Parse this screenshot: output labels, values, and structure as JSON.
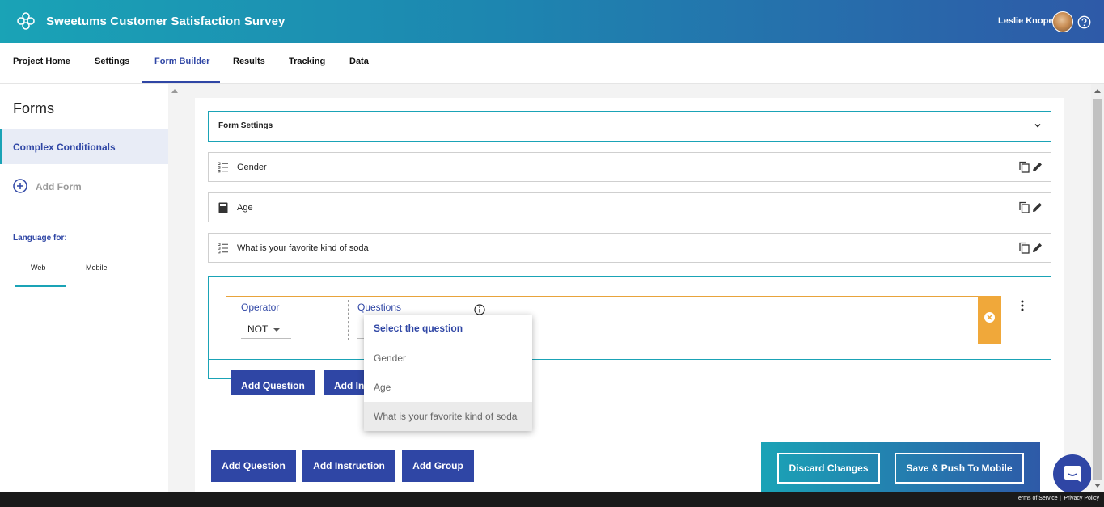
{
  "header": {
    "app_title": "Sweetums Customer Satisfaction Survey",
    "user_name": "Leslie Knope",
    "colors": {
      "gradient_start": "#1aa3b6",
      "gradient_end": "#2e5aa8"
    }
  },
  "tabs": [
    {
      "label": "Project Home"
    },
    {
      "label": "Settings"
    },
    {
      "label": "Form Builder",
      "active": true
    },
    {
      "label": "Results"
    },
    {
      "label": "Tracking"
    },
    {
      "label": "Data"
    }
  ],
  "sidebar": {
    "heading": "Forms",
    "forms": [
      {
        "label": "Complex Conditionals",
        "selected": true
      }
    ],
    "add_form_label": "Add Form",
    "language_label": "Language for:",
    "language_tabs": [
      {
        "label": "Web",
        "active": true
      },
      {
        "label": "Mobile"
      }
    ]
  },
  "builder": {
    "form_settings_label": "Form Settings",
    "questions": [
      {
        "label": "Gender",
        "icon": "list-icon"
      },
      {
        "label": "Age",
        "icon": "calculator-icon"
      },
      {
        "label": "What is your favorite kind of soda",
        "icon": "list-icon"
      }
    ],
    "condition": {
      "operator_label": "Operator",
      "operator_value": "NOT",
      "questions_label": "Questions"
    },
    "dropdown": {
      "header": "Select the question",
      "options": [
        {
          "label": "Gender"
        },
        {
          "label": "Age"
        },
        {
          "label": "What is your favorite kind of soda",
          "hovered": true
        }
      ]
    },
    "inner_buttons": {
      "add_question": "Add Question",
      "add_instruction": "Add Instruction"
    },
    "bottom_buttons": {
      "add_question": "Add Question",
      "add_instruction": "Add Instruction",
      "add_group": "Add Group"
    }
  },
  "action_bar": {
    "discard_label": "Discard Changes",
    "save_label": "Save & Push To Mobile"
  },
  "footer": {
    "terms": "Terms of Service",
    "privacy": "Privacy Policy"
  }
}
